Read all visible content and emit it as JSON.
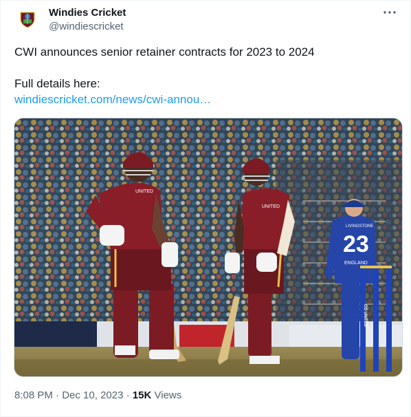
{
  "tweet": {
    "author_name": "Windies Cricket",
    "author_handle": "@windiescricket",
    "line1": "CWI announces senior retainer contracts for 2023 to 2024",
    "line2": "Full details here:",
    "link_text": "windiescricket.com/news/cwi-annou…",
    "time": "8:08 PM",
    "date": "Dec 10, 2023",
    "views_count": "15K",
    "views_label": "Views",
    "separator": "·"
  },
  "photo": {
    "player_left_shirt": "UNITED",
    "player_right_shirt": "UNITED",
    "opponent_number": "23",
    "opponent_name": "LIVINGSTONE",
    "opponent_shirt": "ENGLAND",
    "stumps_text": "CG UNITED"
  },
  "colors": {
    "maroon": "#7b1c24",
    "link": "#1d9bf0",
    "muted": "#536471",
    "england_blue": "#2545a8"
  }
}
